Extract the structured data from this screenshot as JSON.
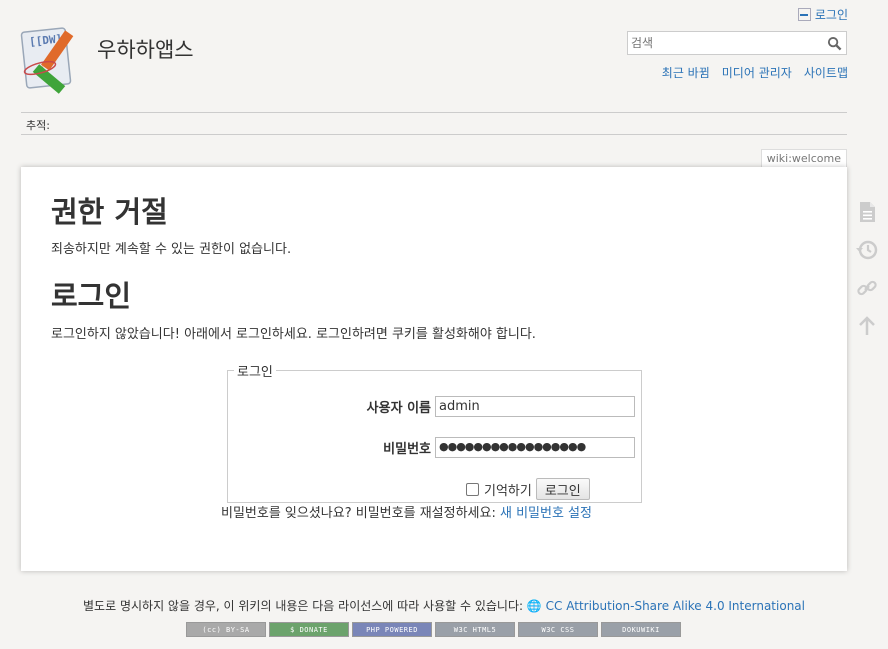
{
  "site": {
    "title": "우하하앱스"
  },
  "user_tools": {
    "login": "로그인"
  },
  "search": {
    "placeholder": "검색"
  },
  "site_tools": {
    "recent": "최근 바뀜",
    "media": "미디어 관리자",
    "sitemap": "사이트맵"
  },
  "breadcrumbs": {
    "label": "추적:"
  },
  "page_id": "wiki:welcome",
  "content": {
    "denied_heading": "권한 거절",
    "denied_text": "죄송하지만 계속할 수 있는 권한이 없습니다.",
    "login_heading": "로그인",
    "login_text": "로그인하지 않았습니다! 아래에서 로그인하세요. 로그인하려면 쿠키를 활성화해야 합니다."
  },
  "login_form": {
    "legend": "로그인",
    "username_label": "사용자 이름",
    "username_value": "admin",
    "password_label": "비밀번호",
    "password_value": "●●●●●●●●●●●●●●●●●",
    "remember_label": "기억하기",
    "submit_label": "로그인"
  },
  "forgot": {
    "text": "비밀번호를 잊으셨나요? 비밀번호를 재설정하세요:",
    "link": "새 비밀번호 설정"
  },
  "footer": {
    "license_text": "별도로 명시하지 않을 경우, 이 위키의 내용은 다음 라이선스에 따라 사용할 수 있습니다:",
    "license_link": "CC Attribution-Share Alike 4.0 International",
    "badges": [
      "(cc) BY-SA",
      "$ DONATE",
      "PHP POWERED",
      "W3C HTML5",
      "W3C CSS",
      "DOKUWIKI"
    ]
  }
}
